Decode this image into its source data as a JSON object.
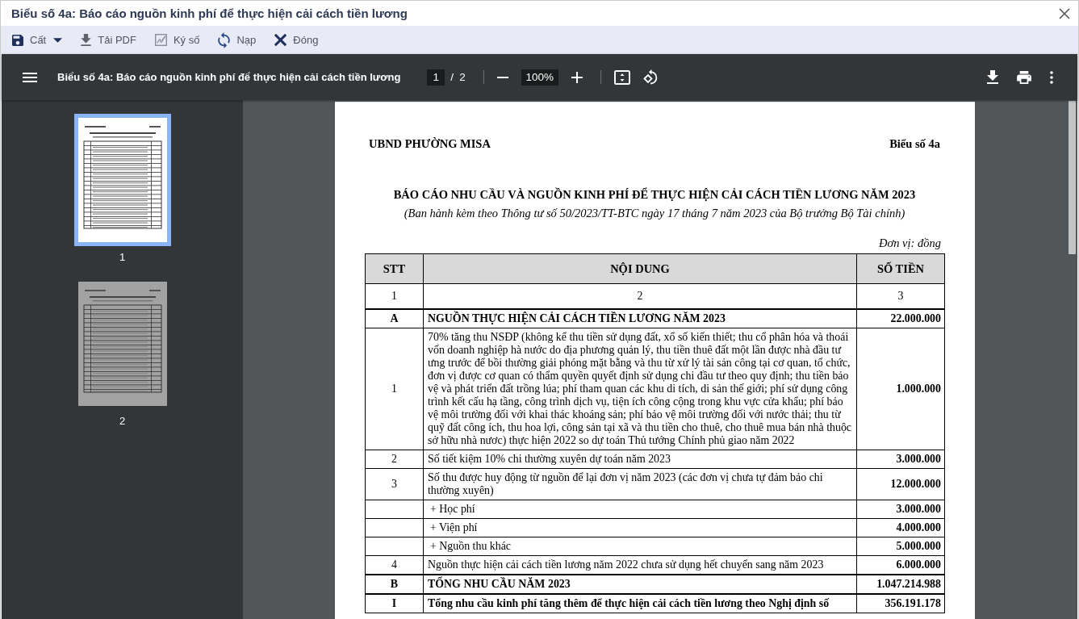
{
  "window": {
    "title": "Biểu số 4a: Báo cáo nguồn kinh phí để thực hiện cải cách tiền lương"
  },
  "toolbar": [
    {
      "kind": "save",
      "label": "Cất",
      "dropdown": true
    },
    {
      "kind": "download",
      "label": "Tải PDF",
      "dropdown": false
    },
    {
      "kind": "sign",
      "label": "Ký số",
      "dropdown": false
    },
    {
      "kind": "reload",
      "label": "Nạp",
      "dropdown": false
    },
    {
      "kind": "close",
      "label": "Đóng",
      "dropdown": false
    }
  ],
  "viewer": {
    "title": "Biểu số 4a: Báo cáo nguồn kinh phí để thực hiện cải cách tiền lương",
    "page": "1",
    "page_separator": "/",
    "page_count": "2",
    "zoom": "100%"
  },
  "thumbnails": [
    {
      "label": "1",
      "selected": true
    },
    {
      "label": "2",
      "selected": false
    }
  ],
  "document": {
    "org": "UBND PHƯỜNG MISA",
    "form_no": "Biểu số 4a",
    "title": "BÁO CÁO NHU CẦU VÀ NGUỒN KINH PHÍ ĐỂ THỰC HIỆN CẢI CÁCH TIỀN LƯƠNG NĂM 2023",
    "subtitle": "(Ban hành kèm theo Thông tư số 50/2023/TT-BTC ngày 17 tháng 7 năm 2023 của Bộ trưởng Bộ Tài chính)",
    "unit": "Đơn vị: đồng",
    "table": {
      "columns": [
        "STT",
        "NỘI DUNG",
        "SỐ TIỀN"
      ],
      "column_numbers": [
        "1",
        "2",
        "3"
      ],
      "rows": [
        {
          "kind": "group",
          "stt": "A",
          "content": "NGUỒN THỰC HIỆN CẢI CÁCH TIỀN LƯƠNG NĂM 2023",
          "amount": "22.000.000"
        },
        {
          "kind": "item",
          "stt": "1",
          "content": "70% tăng thu NSĐP (không kể thu tiền sử dụng đất, xổ số kiến thiết; thu cổ phân hóa và thoái vốn doanh nghiệp hà nước do địa phương quản lý, thu tiền thuê đất một lần được nhà đầu tư ưng trước để bồi thường giải phóng mặt bằng và thu từ xử lý tài sản công tại cơ quan, tổ chức, đơn vị được cơ quan có thẩm quyền quyết định sử dụng chi đầu tư theo quy định; thu tiền bảo vệ và phát triển đất trồng lúa; phí tham quan các khu di tích, di sản thế giới; phí sử dụng công trình kết cấu hạ tầng, công trình dịch vụ, tiện ích công cộng trong khu vực cửa khẩu; phí bảo vệ môi trường đối với khai thác khoáng sản; phí bảo vệ môi trường đối với nước thải; thu từ quỹ đất công ích, thu hoa lợi, công sản tại xã và thu tiền cho thuê, cho thuê mua bán nhà thuộc sở hữu nhà nươc) thực hiện 2022 so dự toán Thủ tướng Chính phủ giao năm 2022",
          "amount": "1.000.000"
        },
        {
          "kind": "item",
          "stt": "2",
          "content": "Số tiết kiệm 10% chi thường xuyên dự toán năm 2023",
          "amount": "3.000.000"
        },
        {
          "kind": "item",
          "stt": "3",
          "content": "Số thu được huy động từ nguồn để lại đơn vị năm 2023 (các đơn vị chưa tự đảm bảo chi thường xuyên)",
          "amount": "12.000.000"
        },
        {
          "kind": "sub",
          "content": "+ Học phí",
          "amount": "3.000.000"
        },
        {
          "kind": "sub",
          "content": "+ Viện phí",
          "amount": "4.000.000"
        },
        {
          "kind": "sub",
          "content": "+ Nguồn thu khác",
          "amount": "5.000.000"
        },
        {
          "kind": "item",
          "stt": "4",
          "content": "Nguồn thực hiện cải cách tiền lương năm 2022 chưa sử dụng hết chuyển sang năm 2023",
          "amount": "6.000.000"
        },
        {
          "kind": "group",
          "stt": "B",
          "content": "TỔNG NHU CẦU NĂM 2023",
          "amount": "1.047.214.988"
        },
        {
          "kind": "group",
          "stt": "I",
          "content": "Tổng nhu cầu kinh phí tăng thêm để thực hiện cải cách tiền lương theo Nghị định số",
          "amount": "356.191.178"
        }
      ]
    }
  }
}
